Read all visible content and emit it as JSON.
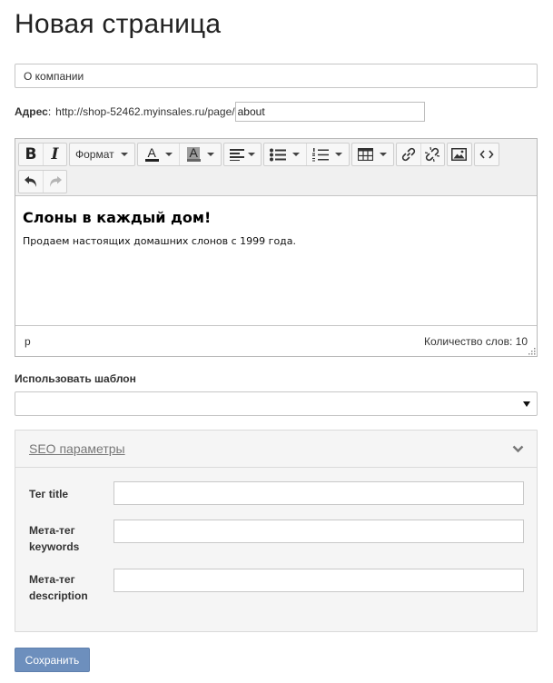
{
  "page": {
    "title": "Новая страница"
  },
  "form": {
    "title_value": "О компании",
    "address": {
      "label": "Адрес",
      "colon": ":",
      "prefix": "http://shop-52462.myinsales.ru/page/",
      "slug_value": "about"
    }
  },
  "editor": {
    "toolbar": {
      "bold": "B",
      "italic": "I",
      "format_label": "Формат",
      "text_color_glyph": "A",
      "bg_color_glyph": "A",
      "icons": [
        "bold-icon",
        "italic-icon",
        "text-color-icon",
        "background-color-icon",
        "align-left-icon",
        "bullet-list-icon",
        "numbered-list-icon",
        "table-icon",
        "link-icon",
        "unlink-icon",
        "image-icon",
        "source-code-icon",
        "undo-icon",
        "redo-icon"
      ]
    },
    "content": {
      "heading": "Слоны в каждый дом!",
      "paragraph": "Продаем настоящих домашних слонов с 1999 года."
    },
    "status": {
      "path": "p",
      "word_count": "Количество слов: 10"
    }
  },
  "template": {
    "label": "Использовать шаблон",
    "selected": ""
  },
  "seo": {
    "header": "SEO параметры",
    "fields": [
      {
        "label": "Тег title",
        "value": ""
      },
      {
        "label": "Мета-тег keywords",
        "value": ""
      },
      {
        "label": "Мета-тег description",
        "value": ""
      }
    ]
  },
  "actions": {
    "save_label": "Сохранить"
  },
  "colors": {
    "save_button_bg": "#6d8fbd",
    "panel_bg": "#f5f5f5",
    "toolbar_bg": "#f0f0f0"
  }
}
